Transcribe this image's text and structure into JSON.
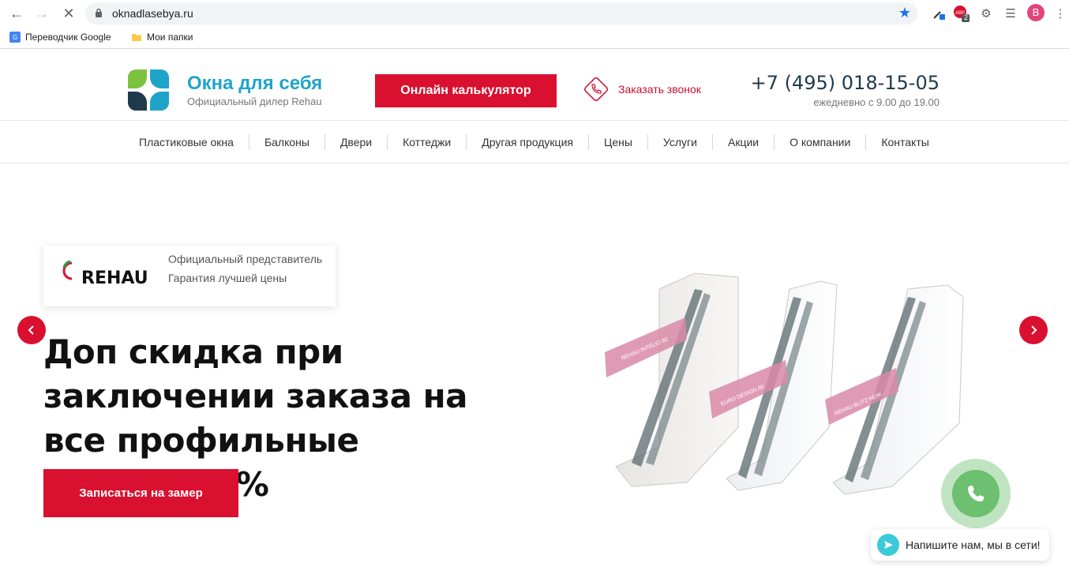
{
  "browser": {
    "url": "oknadlasebya.ru",
    "bookmarks": [
      {
        "label": "Переводчик Google"
      },
      {
        "label": "Мои папки"
      }
    ],
    "profile_initial": "B",
    "abp_count": "2"
  },
  "header": {
    "brand_title": "Окна для себя",
    "brand_subtitle": "Официальный дилер Rehau",
    "calc_button": "Онлайн калькулятор",
    "callback_label": "Заказать звонок",
    "phone": "+7 (495) 018-15-05",
    "hours": "ежедневно с 9.00 до 19.00"
  },
  "menu": {
    "items": [
      {
        "label": "Пластиковые окна"
      },
      {
        "label": "Балконы"
      },
      {
        "label": "Двери"
      },
      {
        "label": "Коттеджи"
      },
      {
        "label": "Другая продукция"
      },
      {
        "label": "Цены"
      },
      {
        "label": "Услуги"
      },
      {
        "label": "Акции"
      },
      {
        "label": "О компании"
      },
      {
        "label": "Контакты"
      }
    ]
  },
  "hero": {
    "badge_line1": "Официальный представитель",
    "badge_line2": "Гарантия лучшей цены",
    "rehau_wordmark": "REHAU",
    "headline": "Доп скидка при заключении заказа на все профильные системы 5%",
    "cta_button": "Записаться на замер",
    "profile_labels": [
      "REHAU INTELIO 80",
      "EURO DESIGN 60",
      "REHAU BLITZ NEW"
    ]
  },
  "widgets": {
    "chat_text": "Напишите нам, мы в сети!"
  },
  "colors": {
    "accent_red": "#d9102f",
    "brand_blue": "#1fa4c9",
    "call_green": "#6cc070"
  }
}
